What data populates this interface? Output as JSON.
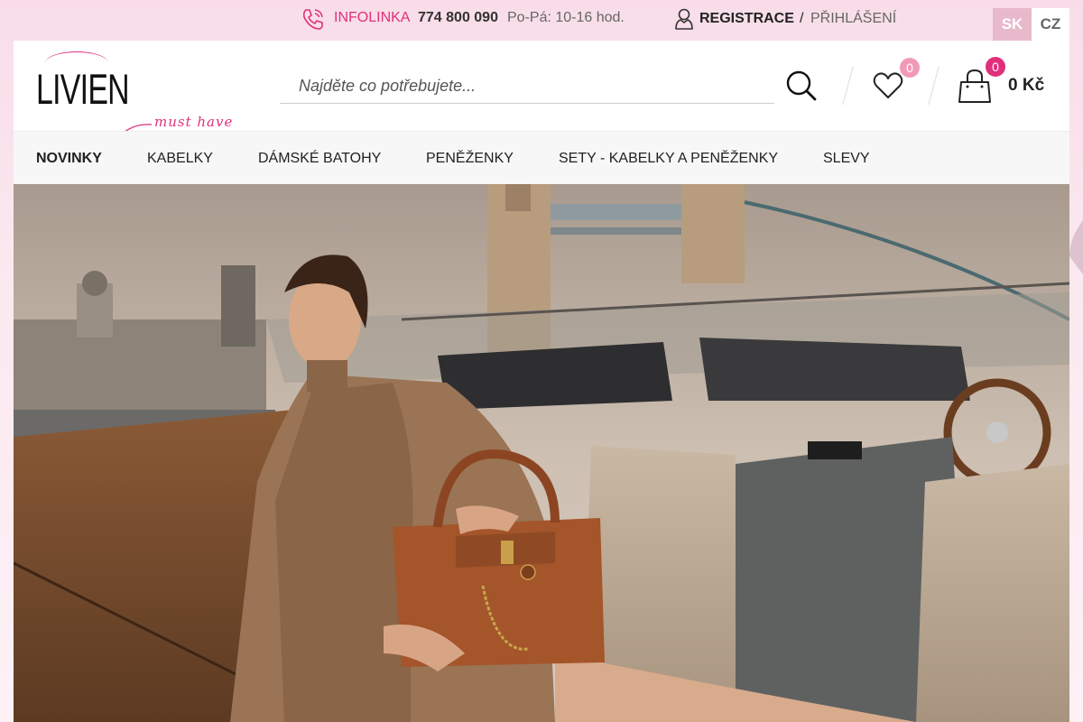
{
  "topbar": {
    "infolinka_label": "INFOLINKA",
    "phone_number": "774 800 090",
    "hours": "Po-Pá: 10-16 hod.",
    "register_label": "REGISTRACE",
    "separator": "/",
    "login_label": "PŘIHLÁŠENÍ",
    "languages": [
      {
        "code": "SK",
        "active": true
      },
      {
        "code": "CZ",
        "active": false
      }
    ]
  },
  "header": {
    "logo_text": "LIVIEN",
    "search": {
      "placeholder": "Najděte co potřebujete...",
      "value": ""
    },
    "wishlist_count": "0",
    "cart_count": "0",
    "cart_total": "0 Kč",
    "tagline": "must have"
  },
  "nav": {
    "items": [
      {
        "label": "NOVINKY",
        "active": true
      },
      {
        "label": "KABELKY",
        "active": false
      },
      {
        "label": "DÁMSKÉ BATOHY",
        "active": false
      },
      {
        "label": "PENĚŽENKY",
        "active": false
      },
      {
        "label": "SETY - KABELKY A PENĚŽENKY",
        "active": false
      },
      {
        "label": "SLEVY",
        "active": false
      }
    ]
  },
  "icons": {
    "phone": "phone-icon",
    "user": "user-icon",
    "search": "search-icon",
    "wishlist": "heart-icon",
    "cart": "shopping-bag-icon"
  },
  "colors": {
    "accent": "#e0307a",
    "accent_light": "#f19ab6",
    "lang_active_bg": "#e8b9cb",
    "page_bg": "#f8dde8",
    "nav_bg": "#f7f7f7"
  }
}
